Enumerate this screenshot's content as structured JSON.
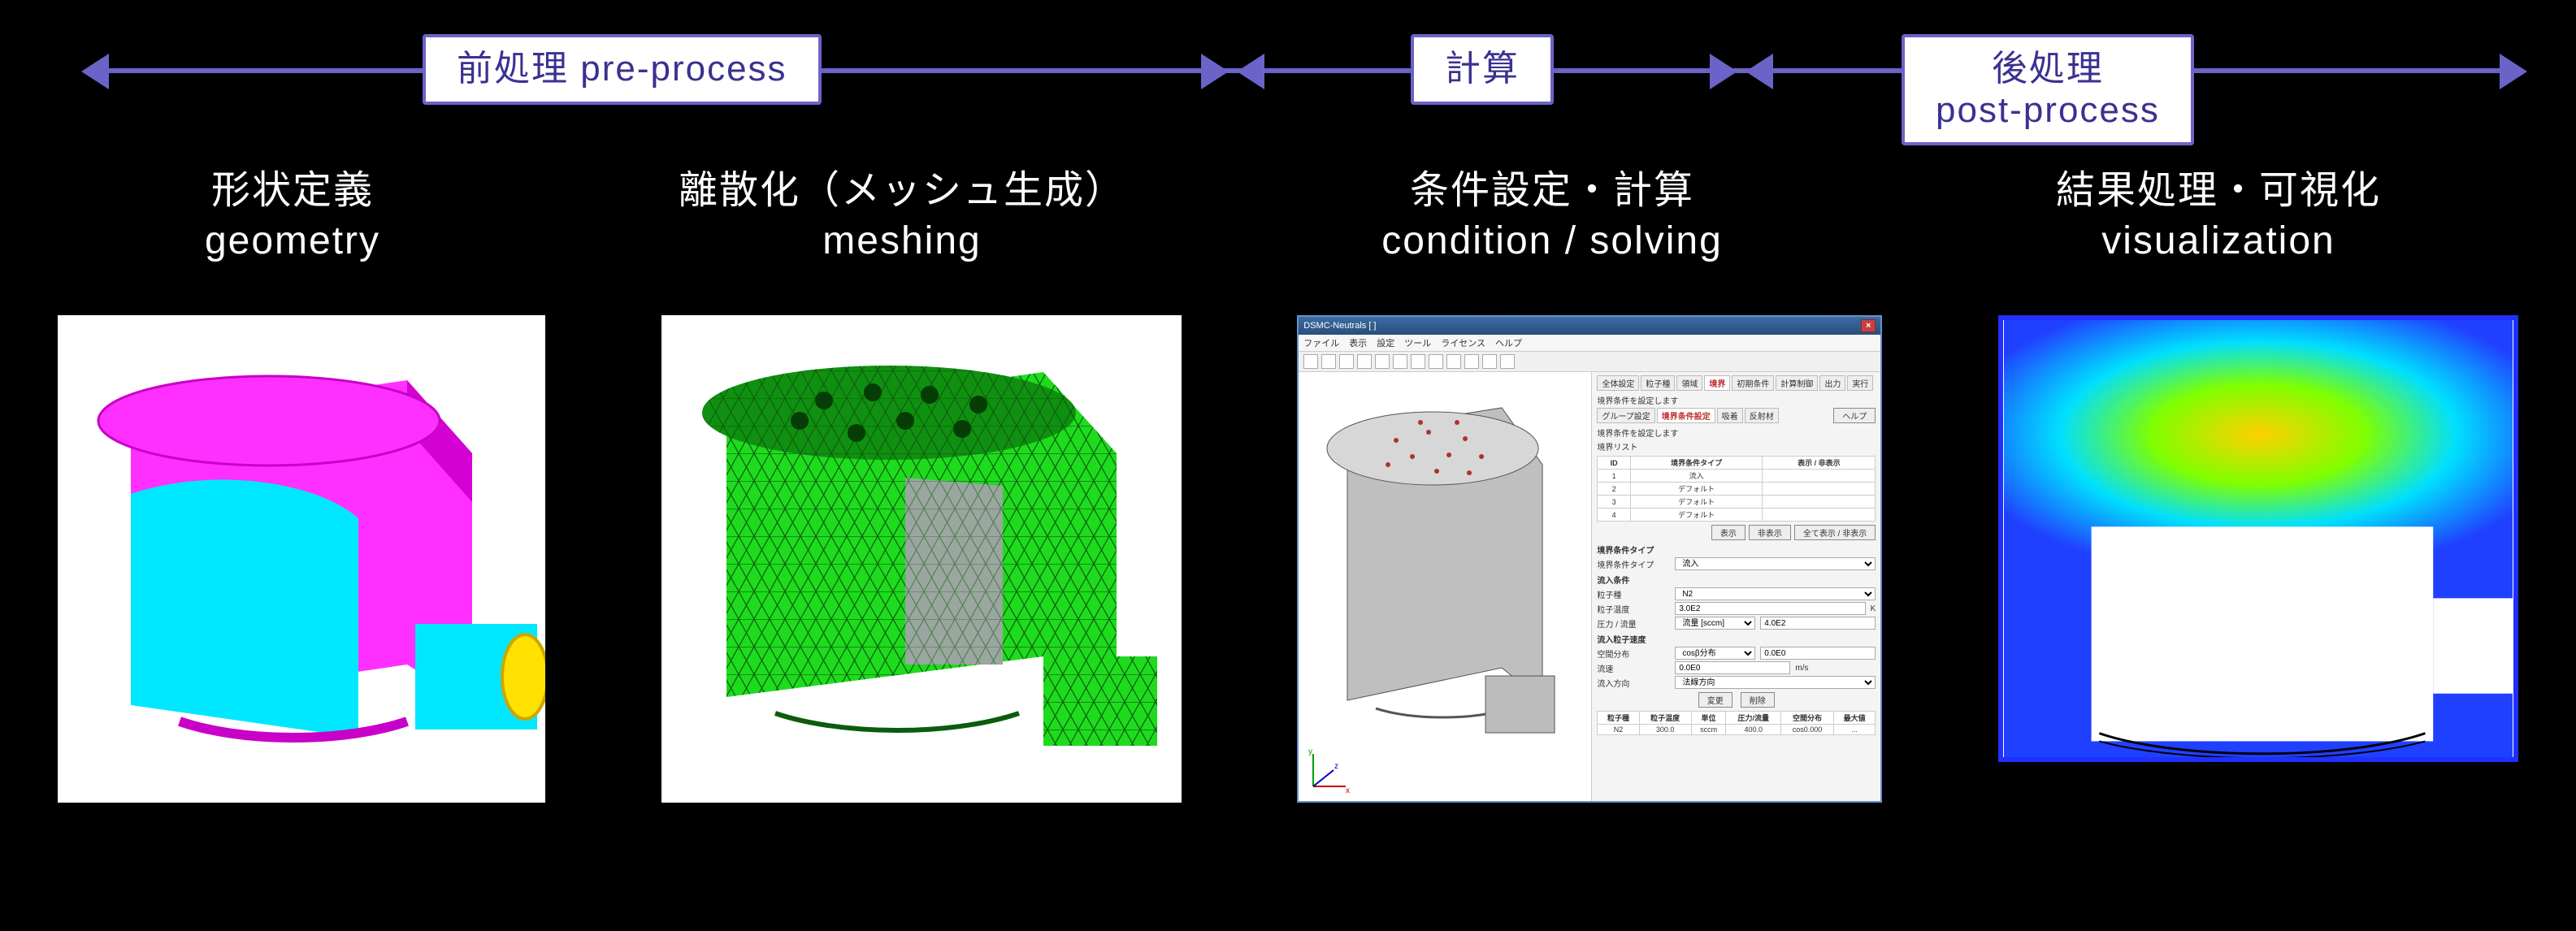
{
  "phases": {
    "pre": {
      "label_ja": "前処理",
      "label_en": "pre-process"
    },
    "calc": {
      "label_ja": "計算",
      "label_en": ""
    },
    "post": {
      "label_ja": "後処理",
      "label_en": "post-process"
    }
  },
  "stages": {
    "geom": {
      "line1": "形状定義",
      "line2": "geometry"
    },
    "mesh": {
      "line1": "離散化（メッシュ生成）",
      "line2": "meshing"
    },
    "cond": {
      "line1": "条件設定・計算",
      "line2": "condition / solving"
    },
    "result": {
      "line1": "結果処理・可視化",
      "line2": "visualization"
    }
  },
  "sim_window": {
    "title": "DSMC-Neutrals [ ]",
    "menu": [
      "ファイル",
      "表示",
      "設定",
      "ツール",
      "ライセンス",
      "ヘルプ"
    ],
    "top_tabs": [
      "全体設定",
      "粒子種",
      "領域",
      "境界",
      "初期条件",
      "計算制御",
      "出力",
      "実行"
    ],
    "top_tabs_active": "境界",
    "panel_caption": "境界条件を設定します",
    "sub_tabs": [
      "グループ設定",
      "境界条件設定",
      "吸着",
      "反射材"
    ],
    "sub_tabs_active": "境界条件設定",
    "help_btn": "ヘルプ",
    "section1": "境界条件を設定します",
    "list_label": "境界リスト",
    "list_header": [
      "ID",
      "境界条件タイプ",
      "表示 / 非表示"
    ],
    "list_rows": [
      [
        "1",
        "流入",
        ""
      ],
      [
        "2",
        "デフォルト",
        ""
      ],
      [
        "3",
        "デフォルト",
        ""
      ],
      [
        "4",
        "デフォルト",
        ""
      ]
    ],
    "show_btns": {
      "show": "表示",
      "hide": "非表示",
      "show_all": "全て表示 / 非表示"
    },
    "type_group": "境界条件タイプ",
    "type_label": "境界条件タイプ",
    "type_value": "流入",
    "species_label": "粒子種",
    "species_value": "N2",
    "inflow_group": "流入条件",
    "temp_label": "粒子温度",
    "temp_value": "3.0E2",
    "temp_unit": "K",
    "pres_label": "圧力 / 流量",
    "pres_mode": "流量 [sccm]",
    "pres_value": "4.0E2",
    "vel_group": "流入粒子速度",
    "dist_label": "空間分布",
    "dist_mode": "cosβ分布",
    "dist_a": "0.0E0",
    "dist_b": "0.0E0",
    "vel_label": "流速",
    "vel_unit": "m/s",
    "dir_label": "流入方向",
    "dir_value": "法線方向",
    "apply_btn": "変更",
    "delete_btn": "削除",
    "summary_header": [
      "粒子種",
      "粒子温度",
      "単位",
      "圧力/流量",
      "空間分布",
      "最大値"
    ],
    "summary_row": [
      "N2",
      "300.0",
      "sccm",
      "400.0",
      "cos0.000",
      "..."
    ]
  }
}
